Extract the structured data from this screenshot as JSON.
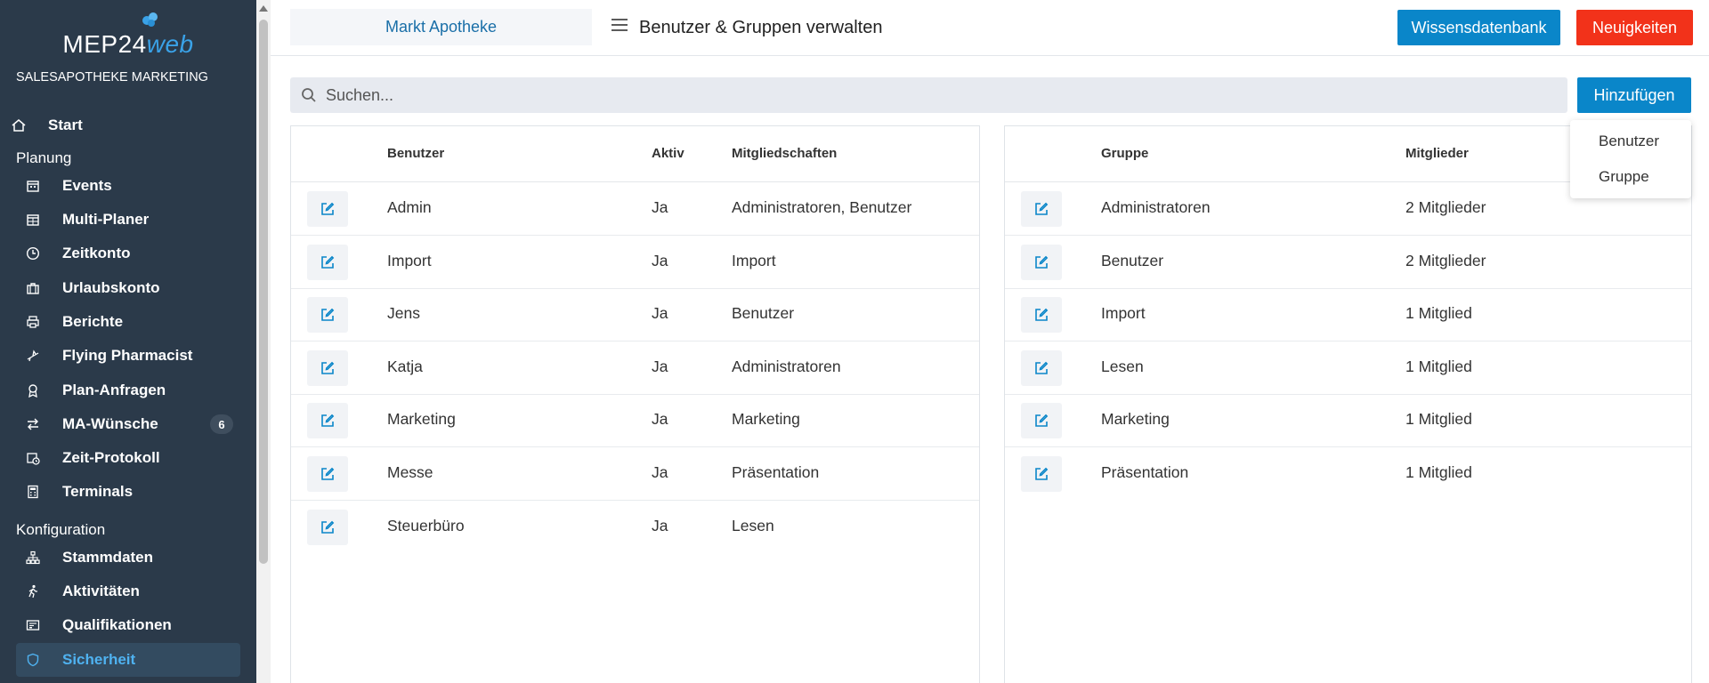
{
  "app": {
    "logo_text_main": "MEP24",
    "logo_text_web": "web",
    "org_name": "SALESAPOTHEKE MARKETING"
  },
  "sidebar": {
    "start_label": "Start",
    "sections": [
      {
        "title": "Planung",
        "items": [
          {
            "label": "Events",
            "icon": "calendar-icon"
          },
          {
            "label": "Multi-Planer",
            "icon": "calendar-grid-icon"
          },
          {
            "label": "Zeitkonto",
            "icon": "clock-icon"
          },
          {
            "label": "Urlaubskonto",
            "icon": "suitcase-icon"
          },
          {
            "label": "Berichte",
            "icon": "printer-icon"
          },
          {
            "label": "Flying Pharmacist",
            "icon": "plane-icon"
          },
          {
            "label": "Plan-Anfragen",
            "icon": "award-icon"
          },
          {
            "label": "MA-Wünsche",
            "icon": "swap-icon",
            "badge": "6"
          },
          {
            "label": "Zeit-Protokoll",
            "icon": "calendar-clock-icon"
          },
          {
            "label": "Terminals",
            "icon": "calculator-icon"
          }
        ]
      },
      {
        "title": "Konfiguration",
        "items": [
          {
            "label": "Stammdaten",
            "icon": "sitemap-icon"
          },
          {
            "label": "Aktivitäten",
            "icon": "walking-icon"
          },
          {
            "label": "Qualifikationen",
            "icon": "certificate-icon"
          },
          {
            "label": "Sicherheit",
            "icon": "shield-icon",
            "active": true
          }
        ]
      }
    ]
  },
  "header": {
    "store_name": "Markt Apotheke",
    "title": "Benutzer & Gruppen verwalten",
    "knowledge_button": "Wissensdatenbank",
    "news_button": "Neuigkeiten"
  },
  "search": {
    "placeholder": "Suchen...",
    "value": ""
  },
  "add_button": {
    "label": "Hinzufügen",
    "options": [
      "Benutzer",
      "Gruppe"
    ]
  },
  "users_table": {
    "columns": [
      "Benutzer",
      "Aktiv",
      "Mitgliedschaften"
    ],
    "rows": [
      {
        "name": "Admin",
        "active": "Ja",
        "memberships": "Administratoren, Benutzer"
      },
      {
        "name": "Import",
        "active": "Ja",
        "memberships": "Import"
      },
      {
        "name": "Jens",
        "active": "Ja",
        "memberships": "Benutzer"
      },
      {
        "name": "Katja",
        "active": "Ja",
        "memberships": "Administratoren"
      },
      {
        "name": "Marketing",
        "active": "Ja",
        "memberships": "Marketing"
      },
      {
        "name": "Messe",
        "active": "Ja",
        "memberships": "Präsentation"
      },
      {
        "name": "Steuerbüro",
        "active": "Ja",
        "memberships": "Lesen"
      }
    ]
  },
  "groups_table": {
    "columns": [
      "Gruppe",
      "Mitglieder"
    ],
    "rows": [
      {
        "name": "Administratoren",
        "members": "2 Mitglieder"
      },
      {
        "name": "Benutzer",
        "members": "2 Mitglieder"
      },
      {
        "name": "Import",
        "members": "1 Mitglied"
      },
      {
        "name": "Lesen",
        "members": "1 Mitglied"
      },
      {
        "name": "Marketing",
        "members": "1 Mitglied"
      },
      {
        "name": "Präsentation",
        "members": "1 Mitglied"
      }
    ]
  },
  "colors": {
    "sidebar_bg": "#2b3a4a",
    "accent_blue": "#0a86c9",
    "news_red": "#f2321a",
    "active_text": "#4fb2f0"
  }
}
